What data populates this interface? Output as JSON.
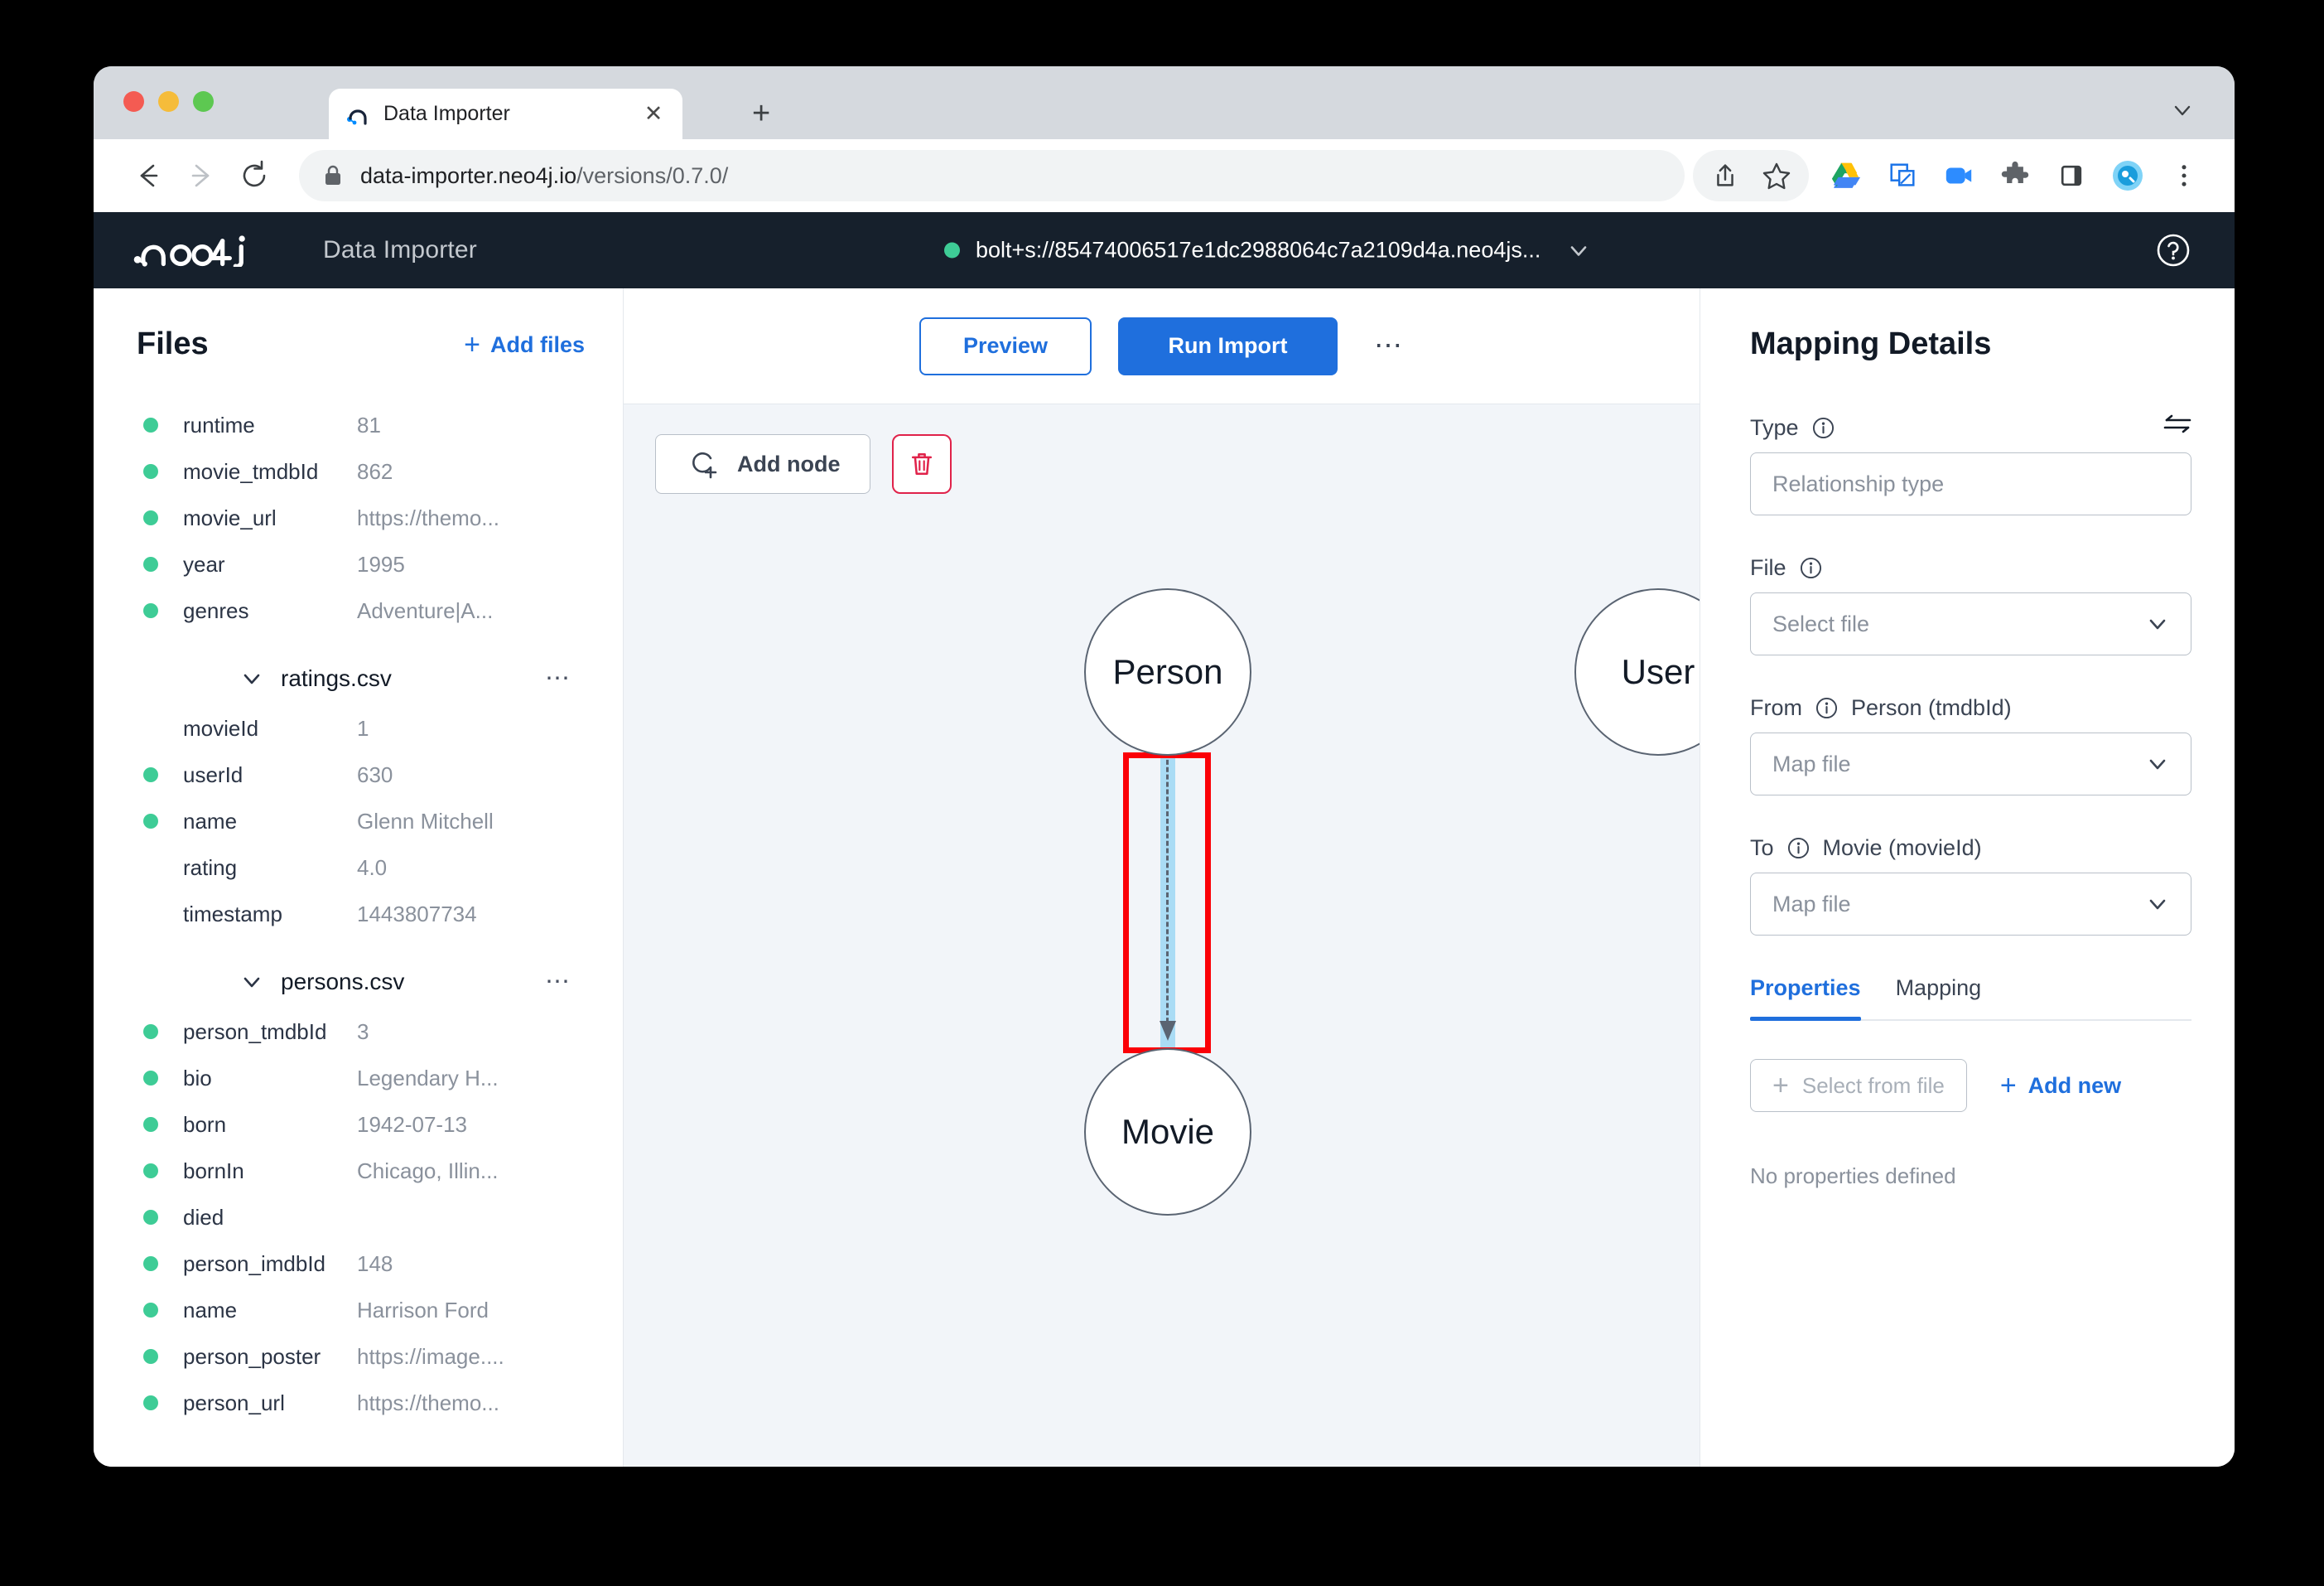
{
  "browser": {
    "tab": {
      "title": "Data Importer",
      "favicon_icon": "neo4j-favicon",
      "close_icon": "close-icon"
    },
    "new_tab_label": "+",
    "tabstrip_chevron_icon": "chevron-down-icon",
    "nav": {
      "back_icon": "back-arrow-icon",
      "forward_icon": "forward-arrow-icon",
      "reload_icon": "reload-icon"
    },
    "omnibox": {
      "lock_icon": "lock-icon",
      "url_domain": "data-importer.neo4j.io",
      "url_path": "/versions/0.7.0/",
      "share_icon": "share-icon",
      "bookmark_icon": "star-icon"
    },
    "extensions": [
      {
        "name": "google-drive-icon"
      },
      {
        "name": "screenshot-icon"
      },
      {
        "name": "zoom-meeting-icon"
      },
      {
        "name": "puzzle-extensions-icon"
      },
      {
        "name": "side-panel-icon"
      },
      {
        "name": "profile-avatar-icon"
      },
      {
        "name": "chrome-menu-icon"
      }
    ]
  },
  "appbar": {
    "logo": "neo4j-logo",
    "product": "Data Importer",
    "connection": "bolt+s://85474006517e1dc2988064c7a2109d4a.neo4js...",
    "connection_status_color": "#3ecc96",
    "connection_chevron_icon": "chevron-down-icon",
    "help_icon": "help-circle-icon"
  },
  "sidebar": {
    "title": "Files",
    "add_files_label": "Add files",
    "add_files_icon": "plus-icon",
    "orphan_fields": [
      {
        "dot": true,
        "name": "runtime",
        "value": "81"
      },
      {
        "dot": true,
        "name": "movie_tmdbId",
        "value": "862"
      },
      {
        "dot": true,
        "name": "movie_url",
        "value": "https://themo..."
      },
      {
        "dot": true,
        "name": "year",
        "value": "1995"
      },
      {
        "dot": true,
        "name": "genres",
        "value": "Adventure|A..."
      }
    ],
    "groups": [
      {
        "name": "ratings.csv",
        "expanded": true,
        "chevron_icon": "chevron-down-icon",
        "more_icon": "more-horizontal-icon",
        "fields": [
          {
            "dot": false,
            "name": "movieId",
            "value": "1"
          },
          {
            "dot": true,
            "name": "userId",
            "value": "630"
          },
          {
            "dot": true,
            "name": "name",
            "value": "Glenn Mitchell"
          },
          {
            "dot": false,
            "name": "rating",
            "value": "4.0"
          },
          {
            "dot": false,
            "name": "timestamp",
            "value": "1443807734"
          }
        ]
      },
      {
        "name": "persons.csv",
        "expanded": true,
        "chevron_icon": "chevron-down-icon",
        "more_icon": "more-horizontal-icon",
        "fields": [
          {
            "dot": true,
            "name": "person_tmdbId",
            "value": "3"
          },
          {
            "dot": true,
            "name": "bio",
            "value": "Legendary H..."
          },
          {
            "dot": true,
            "name": "born",
            "value": "1942-07-13"
          },
          {
            "dot": true,
            "name": "bornIn",
            "value": "Chicago, Illin..."
          },
          {
            "dot": true,
            "name": "died",
            "value": ""
          },
          {
            "dot": true,
            "name": "person_imdbId",
            "value": "148"
          },
          {
            "dot": true,
            "name": "name",
            "value": "Harrison Ford"
          },
          {
            "dot": true,
            "name": "person_poster",
            "value": "https://image...."
          },
          {
            "dot": true,
            "name": "person_url",
            "value": "https://themo..."
          }
        ]
      }
    ]
  },
  "toolbar": {
    "preview_label": "Preview",
    "run_import_label": "Run Import",
    "more_icon": "more-horizontal-icon"
  },
  "canvas": {
    "add_node_label": "Add node",
    "add_node_icon": "add-node-circle-icon",
    "delete_icon": "trash-icon",
    "background_color": "#f2f5f9",
    "nodes": [
      {
        "id": "person",
        "label": "Person"
      },
      {
        "id": "movie",
        "label": "Movie"
      },
      {
        "id": "user",
        "label": "User"
      }
    ],
    "relationship": {
      "from": "Person",
      "to": "Movie",
      "selected": true,
      "selection_color": "#aadcf5",
      "annotation_color": "#fb0007"
    }
  },
  "details": {
    "title": "Mapping Details",
    "swap_icon": "swap-arrows-icon",
    "info_icon": "info-circle-icon",
    "chevron_icon": "chevron-down-icon",
    "type_label": "Type",
    "type_placeholder": "Relationship type",
    "type_value": "",
    "file_label": "File",
    "file_placeholder": "Select file",
    "from_label": "From",
    "from_node": "Person (tmdbId)",
    "from_placeholder": "Map file",
    "to_label": "To",
    "to_node": "Movie (movieId)",
    "to_placeholder": "Map file",
    "tabs": [
      {
        "label": "Properties",
        "active": true
      },
      {
        "label": "Mapping",
        "active": false
      }
    ],
    "select_from_file_label": "Select from file",
    "select_from_file_icon": "plus-icon",
    "add_new_label": "Add new",
    "add_new_icon": "plus-icon",
    "empty_text": "No properties defined"
  }
}
